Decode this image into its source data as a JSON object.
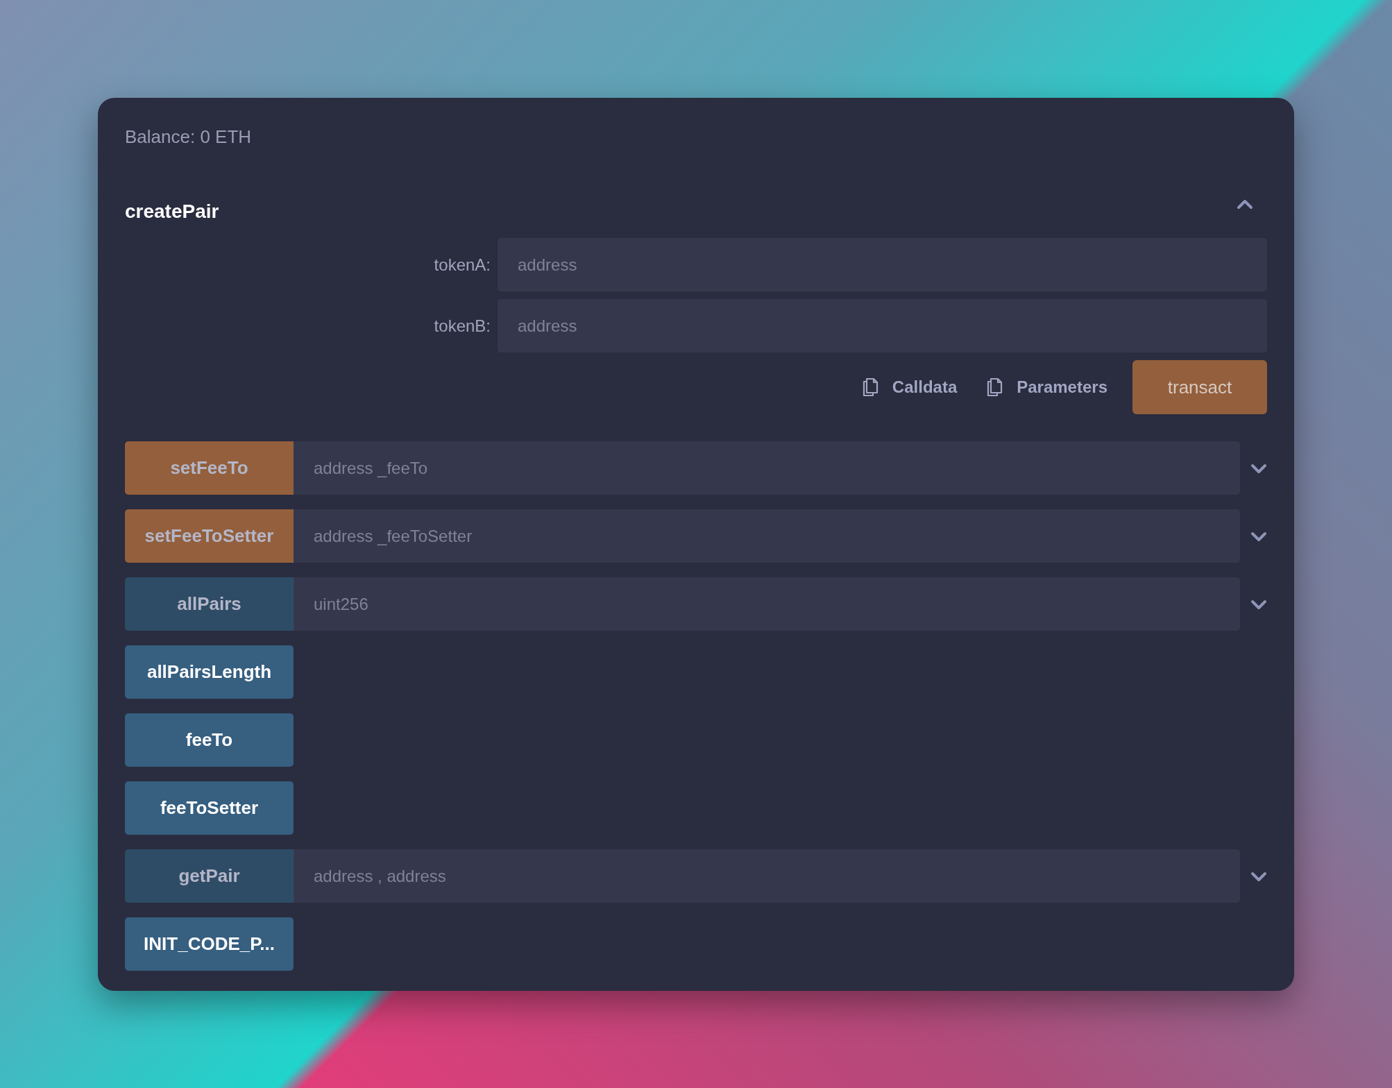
{
  "balance": "Balance: 0 ETH",
  "expanded_function": {
    "name": "createPair",
    "expanded": true,
    "params": [
      {
        "label": "tokenA:",
        "placeholder": "address"
      },
      {
        "label": "tokenB:",
        "placeholder": "address"
      }
    ],
    "copy_actions": [
      "Calldata",
      "Parameters"
    ],
    "submit": "transact"
  },
  "functions": [
    {
      "name": "setFeeTo",
      "kind": "transact",
      "placeholder": "address _feeTo",
      "expanded": false
    },
    {
      "name": "setFeeToSetter",
      "kind": "transact",
      "placeholder": "address _feeToSetter",
      "expanded": false
    },
    {
      "name": "allPairs",
      "kind": "call",
      "placeholder": "uint256",
      "expanded": false
    },
    {
      "name": "allPairsLength",
      "kind": "call"
    },
    {
      "name": "feeTo",
      "kind": "call"
    },
    {
      "name": "feeToSetter",
      "kind": "call"
    },
    {
      "name": "getPair",
      "kind": "call",
      "placeholder": "address , address",
      "expanded": false
    },
    {
      "name": "INIT_CODE_P...",
      "kind": "call"
    }
  ]
}
